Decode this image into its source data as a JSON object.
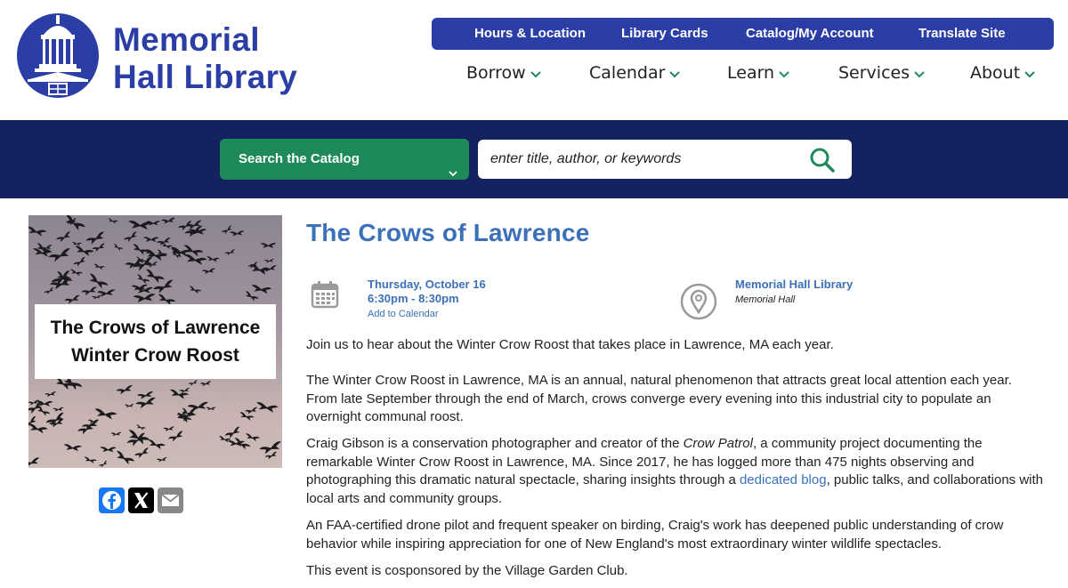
{
  "header": {
    "logo_line1": "Memorial",
    "logo_line2": "Hall Library",
    "top_links": [
      "Hours & Location",
      "Library Cards",
      "Catalog/My Account",
      "Translate Site"
    ],
    "main_nav": [
      "Borrow",
      "Calendar",
      "Learn",
      "Services",
      "About"
    ]
  },
  "search": {
    "catalog_label": "Search the Catalog",
    "placeholder": "enter title, author, or keywords"
  },
  "event": {
    "image_caption_line1": "The Crows of Lawrence",
    "image_caption_line2": "Winter Crow Roost",
    "title": "The Crows of Lawrence",
    "date": "Thursday, October 16",
    "time": "6:30pm - 8:30pm",
    "add_to_calendar": "Add to Calendar",
    "location_name": "Memorial Hall Library",
    "location_room": "Memorial Hall",
    "intro": "Join us to hear about the Winter Crow Roost that takes place in Lawrence, MA each year.",
    "para2": "The Winter Crow Roost in Lawrence, MA is an annual, natural phenomenon that attracts great local attention each year. From late September through the end of March, crows converge every evening into this industrial city to populate an overnight communal roost.",
    "para3_a": "Craig Gibson is a conservation photographer and creator of the ",
    "para3_em": "Crow Patrol",
    "para3_b": ", a community project documenting the remarkable Winter Crow Roost in Lawrence, MA. Since 2017, he has logged more than 475 nights observing and photographing this dramatic natural spectacle, sharing insights through a ",
    "para3_link": "dedicated blog",
    "para3_c": ", public talks, and collaborations with local arts and community groups.",
    "para4": "An FAA-certified drone pilot and frequent speaker on birding, Craig's work has deepened public understanding of crow behavior while inspiring appreciation for one of New England's most extraordinary winter wildlife spectacles.",
    "para5": "This event is cosponsored by the Village Garden Club."
  },
  "colors": {
    "brand_blue": "#2a3ea6",
    "navy": "#152260",
    "green": "#1e8a5a",
    "link_blue": "#3a71b8"
  }
}
